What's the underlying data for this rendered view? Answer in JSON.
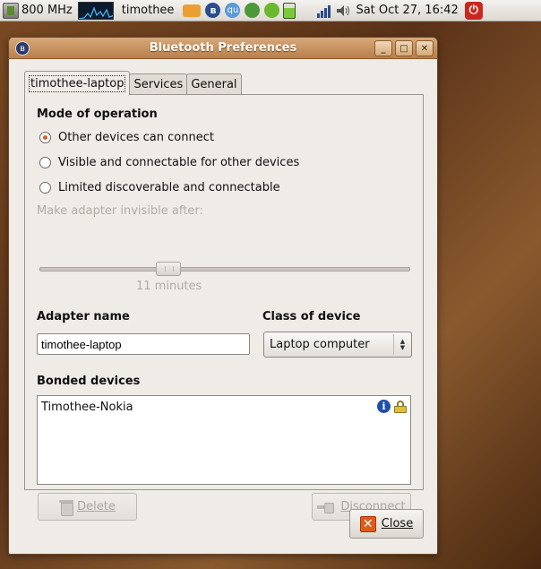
{
  "panel": {
    "cpu_freq": "800 MHz",
    "username": "timothee",
    "datetime": "Sat Oct 27, 16:42",
    "tray_bt_glyph": "ʙ",
    "qu_label": "qu"
  },
  "window": {
    "title": "Bluetooth Preferences",
    "min_glyph": "_",
    "max_glyph": "□",
    "close_glyph": "✕"
  },
  "tabs": [
    {
      "label": "timothee-laptop",
      "active": true
    },
    {
      "label": "Services",
      "active": false
    },
    {
      "label": "General",
      "active": false
    }
  ],
  "mode": {
    "title": "Mode of operation",
    "options": [
      {
        "label": "Other devices can connect",
        "checked": true
      },
      {
        "label": "Visible and connectable for other devices",
        "checked": false
      },
      {
        "label": "Limited discoverable and connectable",
        "checked": false
      }
    ],
    "invisible_label": "Make adapter invisible after:",
    "slider_value_text": "11 minutes",
    "slider_fraction": 0.34
  },
  "adapter": {
    "name_label": "Adapter name",
    "name_value": "timothee-laptop",
    "class_label": "Class of device",
    "class_value": "Laptop computer"
  },
  "bonded": {
    "title": "Bonded devices",
    "devices": [
      "Timothee-Nokia"
    ],
    "info_glyph": "i"
  },
  "buttons": {
    "delete": "Delete",
    "disconnect": "Disconnect",
    "close": "Close"
  }
}
